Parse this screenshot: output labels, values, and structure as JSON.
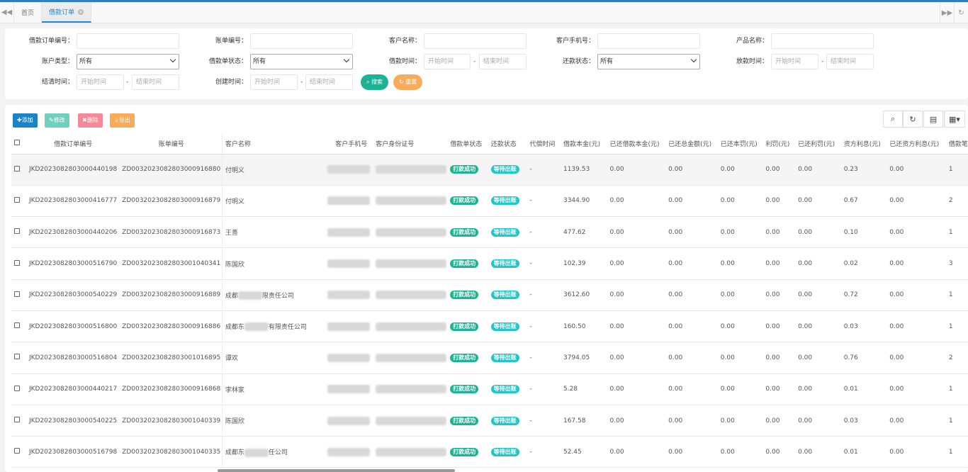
{
  "tabs": {
    "home": "首页",
    "active": "借款订单"
  },
  "filters": {
    "loan_order_no": "借款订单编号：",
    "bill_no": "账单编号：",
    "customer_name": "客户名称：",
    "customer_phone": "客户手机号：",
    "product_name": "产品名称：",
    "account_type": "账户类型：",
    "account_type_value": "所有",
    "loan_status": "借款单状态：",
    "loan_status_value": "所有",
    "loan_time": "借款时间：",
    "repay_status": "还款状态：",
    "repay_status_value": "所有",
    "disburse_time": "放款时间：",
    "settle_time": "结清时间：",
    "create_time": "创建时间：",
    "start_placeholder": "开始时间",
    "end_placeholder": "结束时间",
    "dash": "-",
    "search_btn": "搜索",
    "reset_btn": "重置"
  },
  "toolbar": {
    "add": "添加",
    "edit": "修改",
    "delete": "删除",
    "export": "导出"
  },
  "colors": {
    "primary": "#1c84c6",
    "success": "#1ab394",
    "danger": "#ed5565",
    "warning": "#f8ac59",
    "info": "#23c6c8"
  },
  "table": {
    "headers": [
      "借款订单编号",
      "账单编号",
      "客户名称",
      "客户手机号",
      "客户身份证号",
      "借款单状态",
      "还款状态",
      "代偿时间",
      "借款本金(元)",
      "已还借款本金(元)",
      "已还总金额(元)",
      "已还本罚(元)",
      "利罚(元)",
      "已还利罚(元)",
      "资方利息(元)",
      "已还资方利息(元)",
      "借款笔"
    ],
    "loan_status_badge": "打款成功",
    "repay_status_badge": "等待出账",
    "rows": [
      {
        "order": "JKD2023082803000440198",
        "bill": "ZD0032023082803000916880",
        "name": "付明义",
        "comp": "-",
        "principal": "1139.53",
        "paid_principal": "0.00",
        "paid_total": "0.00",
        "paid_pen": "0.00",
        "penalty": "0.00",
        "paid_penalty": "0.00",
        "interest": "0.23",
        "paid_interest": "0.00",
        "count": "1"
      },
      {
        "order": "JKD2023082803000416777",
        "bill": "ZD0032023082803000916879",
        "name": "付明义",
        "comp": "-",
        "principal": "3344.90",
        "paid_principal": "0.00",
        "paid_total": "0.00",
        "paid_pen": "0.00",
        "penalty": "0.00",
        "paid_penalty": "0.00",
        "interest": "0.67",
        "paid_interest": "0.00",
        "count": "2"
      },
      {
        "order": "JKD2023082803000440206",
        "bill": "ZD0032023082803000916873",
        "name": "王善",
        "comp": "-",
        "principal": "477.62",
        "paid_principal": "0.00",
        "paid_total": "0.00",
        "paid_pen": "0.00",
        "penalty": "0.00",
        "paid_penalty": "0.00",
        "interest": "0.10",
        "paid_interest": "0.00",
        "count": "1"
      },
      {
        "order": "JKD2023082803000516790",
        "bill": "ZD0032023082803001040341",
        "name": "陈国欣",
        "comp": "-",
        "principal": "102.39",
        "paid_principal": "0.00",
        "paid_total": "0.00",
        "paid_pen": "0.00",
        "penalty": "0.00",
        "paid_penalty": "0.00",
        "interest": "0.02",
        "paid_interest": "0.00",
        "count": "3"
      },
      {
        "order": "JKD2023082803000540229",
        "bill": "ZD0032023082803000916889",
        "name": "成都",
        "name2": "限责任公司",
        "comp": "-",
        "principal": "3612.60",
        "paid_principal": "0.00",
        "paid_total": "0.00",
        "paid_pen": "0.00",
        "penalty": "0.00",
        "paid_penalty": "0.00",
        "interest": "0.72",
        "paid_interest": "0.00",
        "count": "1"
      },
      {
        "order": "JKD2023082803000516800",
        "bill": "ZD0032023082803000916886",
        "name": "成都东",
        "name2": "有限责任公司",
        "comp": "-",
        "principal": "160.50",
        "paid_principal": "0.00",
        "paid_total": "0.00",
        "paid_pen": "0.00",
        "penalty": "0.00",
        "paid_penalty": "0.00",
        "interest": "0.03",
        "paid_interest": "0.00",
        "count": "1"
      },
      {
        "order": "JKD2023082803000516804",
        "bill": "ZD0032023082803001016895",
        "name": "谭欢",
        "comp": "-",
        "principal": "3794.05",
        "paid_principal": "0.00",
        "paid_total": "0.00",
        "paid_pen": "0.00",
        "penalty": "0.00",
        "paid_penalty": "0.00",
        "interest": "0.76",
        "paid_interest": "0.00",
        "count": "2"
      },
      {
        "order": "JKD2023082803000440217",
        "bill": "ZD0032023082803000916868",
        "name": "李林家",
        "comp": "-",
        "principal": "5.28",
        "paid_principal": "0.00",
        "paid_total": "0.00",
        "paid_pen": "0.00",
        "penalty": "0.00",
        "paid_penalty": "0.00",
        "interest": "0.01",
        "paid_interest": "0.00",
        "count": "1"
      },
      {
        "order": "JKD2023082803000540225",
        "bill": "ZD0032023082803001040339",
        "name": "陈国欣",
        "comp": "-",
        "principal": "167.58",
        "paid_principal": "0.00",
        "paid_total": "0.00",
        "paid_pen": "0.00",
        "penalty": "0.00",
        "paid_penalty": "0.00",
        "interest": "0.03",
        "paid_interest": "0.00",
        "count": "1"
      },
      {
        "order": "JKD2023082803000516798",
        "bill": "ZD0032023082803001040335",
        "name": "成都东",
        "name2": "任公司",
        "comp": "-",
        "principal": "52.45",
        "paid_principal": "0.00",
        "paid_total": "0.00",
        "paid_pen": "0.00",
        "penalty": "0.00",
        "paid_penalty": "0.00",
        "interest": "0.01",
        "paid_interest": "0.00",
        "count": "1"
      }
    ]
  }
}
